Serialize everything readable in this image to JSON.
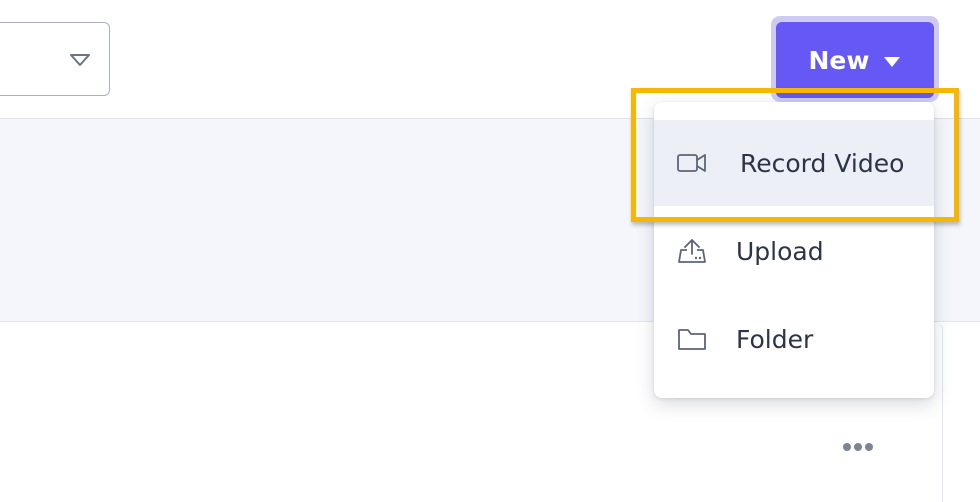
{
  "toolbar": {
    "new_button_label": "New",
    "colors": {
      "accent": "#6558f5",
      "highlight": "#f7b700"
    }
  },
  "filter_select": {
    "value": "",
    "icon": "triangle-down-icon"
  },
  "new_menu": {
    "items": [
      {
        "label": "Record Video",
        "icon": "video-camera-icon",
        "highlighted": true
      },
      {
        "label": "Upload",
        "icon": "upload-icon",
        "highlighted": false
      },
      {
        "label": "Folder",
        "icon": "folder-icon",
        "highlighted": false
      }
    ]
  },
  "card": {
    "more_icon": "more-horizontal-icon"
  }
}
